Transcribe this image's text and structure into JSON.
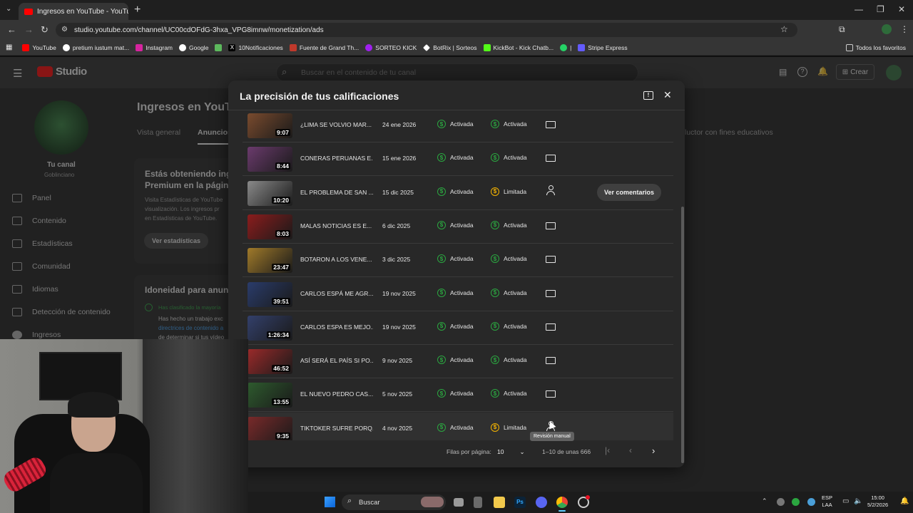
{
  "browser": {
    "tab_title": "Ingresos en YouTube - YouTube",
    "new_tab": "+",
    "url": "studio.youtube.com/channel/UC00cdOFdG-3hxa_VPG8imnw/monetization/ads",
    "bookmarks": [
      "YouTube",
      "pretium iustum mat...",
      "Instagram",
      "Google",
      "10Notificaciones",
      "Fuente de Grand Th...",
      "SORTEO KICK",
      "BotRix | Sorteos",
      "KickBot - Kick Chatb...",
      "|",
      "Stripe Express"
    ],
    "bookmarks_right": "Todos los favoritos"
  },
  "studio": {
    "logo": "Studio",
    "search_placeholder": "Buscar en el contenido de tu canal",
    "create": "Crear",
    "channel_label": "Tu canal",
    "channel_name": "Goblinciano",
    "nav": [
      "Panel",
      "Contenido",
      "Estadísticas",
      "Comunidad",
      "Idiomas",
      "Detección de contenido",
      "Ingresos"
    ],
    "page_title": "Ingresos en YouTub",
    "tabs": [
      "Vista general",
      "Anuncios"
    ],
    "tab_right": "luctor con fines educativos",
    "card1_title": "Estás obteniendo ingre",
    "card1_title2": "Premium en la página",
    "card1_text1": "Visita Estadísticas de YouTube",
    "card1_text2": "visualización. Los ingresos pr",
    "card1_text3": "en Estadísticas de YouTube.",
    "card1_button": "Ver estadísticas",
    "card2_title": "Idoneidad para anunci",
    "card2_check": "Has clasificado la mayoría",
    "card2_text1": "Has hecho un trabajo exc",
    "card2_link": "directrices de contenido a",
    "card2_text2": "de determinar si tus vídeo"
  },
  "modal": {
    "title": "La precisión de tus calificaciones",
    "rows": [
      {
        "duration": "9:07",
        "title": "¿LIMA SE VOLVIO MAR...",
        "date": "24 ene 2026",
        "self": "Activada",
        "final": "Activada",
        "icon": "monitor",
        "thumb": "#7a4b2e"
      },
      {
        "duration": "8:44",
        "title": "CONERAS PERUANAS E...",
        "date": "15 ene 2026",
        "self": "Activada",
        "final": "Activada",
        "icon": "monitor",
        "thumb": "#6b3b6d"
      },
      {
        "duration": "10:20",
        "title": "EL PROBLEMA DE SAN ...",
        "date": "15 dic 2025",
        "self": "Activada",
        "final": "Limitada",
        "icon": "person-check",
        "thumb": "#8a8a8a",
        "action": "Ver comentarios"
      },
      {
        "duration": "8:03",
        "title": "MALAS NOTICIAS ES E...",
        "date": "6 dic 2025",
        "self": "Activada",
        "final": "Activada",
        "icon": "monitor",
        "thumb": "#8b1c1c"
      },
      {
        "duration": "23:47",
        "title": "BOTARON A LOS VENE...",
        "date": "3 dic 2025",
        "self": "Activada",
        "final": "Activada",
        "icon": "monitor",
        "thumb": "#a07a2a"
      },
      {
        "duration": "39:51",
        "title": "CARLOS ESPÁ ME AGR...",
        "date": "19 nov 2025",
        "self": "Activada",
        "final": "Activada",
        "icon": "monitor",
        "thumb": "#2a3c6b"
      },
      {
        "duration": "1:26:34",
        "title": "CARLOS ESPA ES MEJO...",
        "date": "19 nov 2025",
        "self": "Activada",
        "final": "Activada",
        "icon": "monitor",
        "thumb": "#33406b"
      },
      {
        "duration": "46:52",
        "title": "ASÍ SERÁ EL PAÍS SI PO...",
        "date": "9 nov 2025",
        "self": "Activada",
        "final": "Activada",
        "icon": "monitor",
        "thumb": "#9a2a2a"
      },
      {
        "duration": "13:55",
        "title": "EL NUEVO PEDRO CAS...",
        "date": "5 nov 2025",
        "self": "Activada",
        "final": "Activada",
        "icon": "monitor",
        "thumb": "#2e5b2e"
      },
      {
        "duration": "9:35",
        "title": "TIKTOKER SUFRE PORQ...",
        "date": "4 nov 2025",
        "self": "Activada",
        "final": "Limitada",
        "icon": "person",
        "thumb": "#7a2a2a"
      }
    ],
    "tooltip": "Revisión manual",
    "rows_per_page_label": "Filas por página:",
    "rows_per_page": "10",
    "range": "1–10 de unas 666"
  },
  "taskbar": {
    "search": "Buscar",
    "lang1": "ESP",
    "lang2": "LAA",
    "time": "15:00",
    "date": "5/2/2026"
  }
}
